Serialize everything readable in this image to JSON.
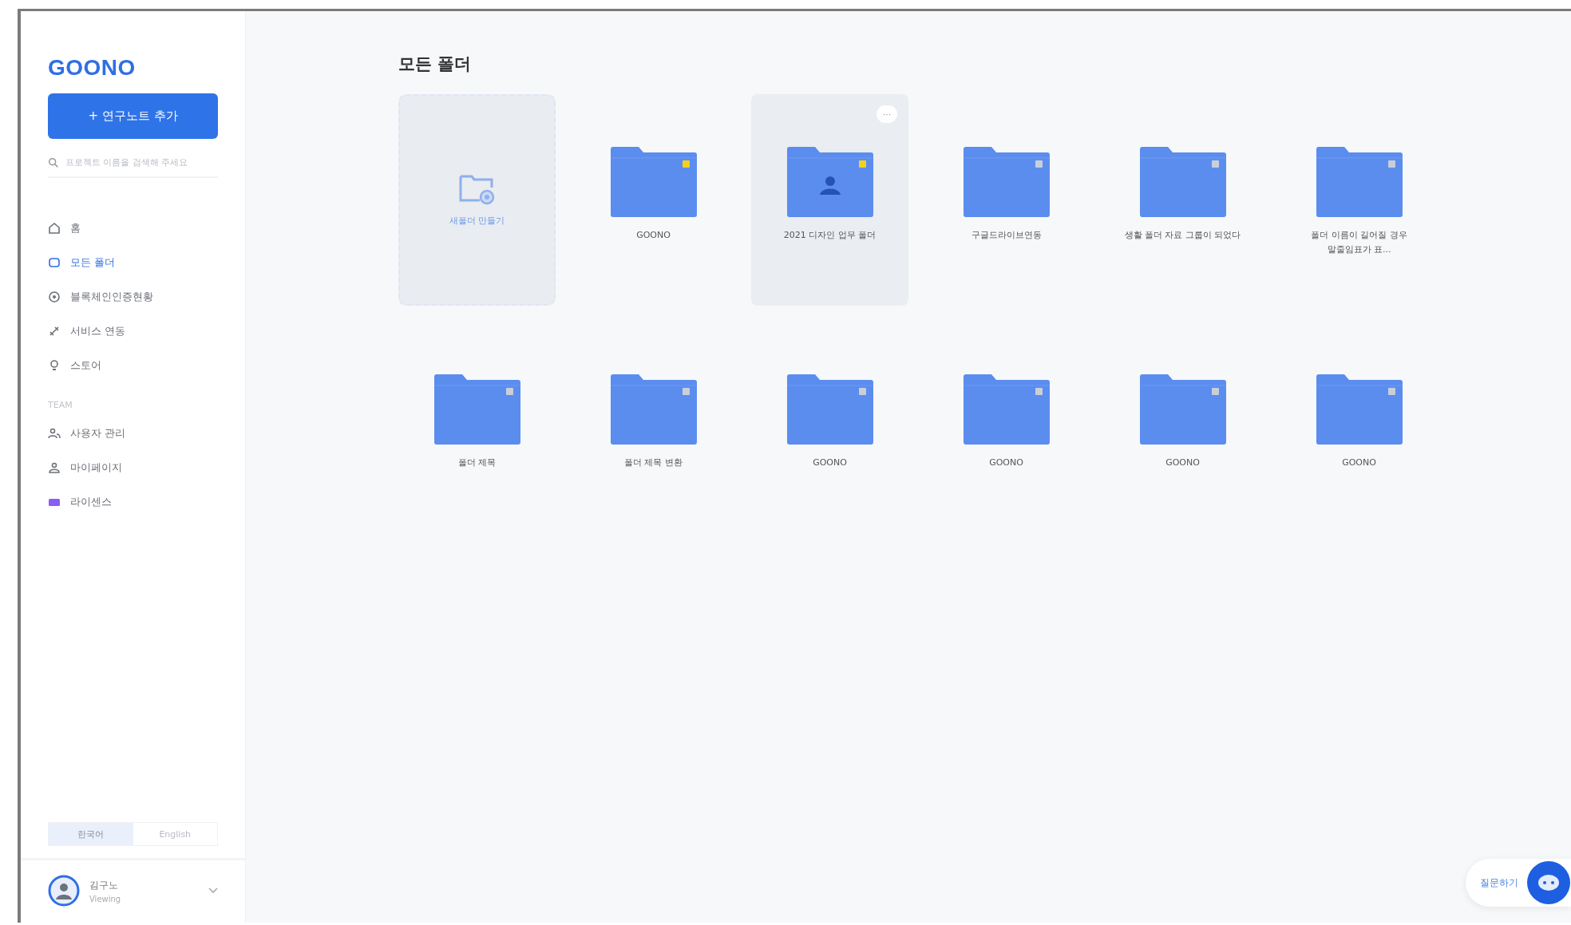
{
  "sidebar": {
    "logo": "GOONO",
    "add_button": "+ 연구노트 추가",
    "search": {
      "placeholder": "프로젝트 이름을 검색해 주세요"
    },
    "nav_items": [
      {
        "label": "홈",
        "selected": false
      },
      {
        "label": "모든 폴더",
        "selected": true
      },
      {
        "label": "블록체인인증현황",
        "selected": false
      },
      {
        "label": "서비스 연동",
        "selected": false
      },
      {
        "label": "스토어",
        "selected": false
      }
    ],
    "section_label": "TEAM",
    "team_items": [
      {
        "label": "사용자 관리",
        "selected": false
      },
      {
        "label": "마이페이지",
        "selected": false
      },
      {
        "label": "라이센스",
        "selected": false
      }
    ],
    "languages": [
      {
        "label": "한국어",
        "selected": true
      },
      {
        "label": "English",
        "selected": false
      }
    ],
    "user": {
      "name": "김구노",
      "role": "Viewing"
    }
  },
  "main": {
    "title": "모든 폴더",
    "new_folder": "새폴더 만들기",
    "folders": [
      {
        "name": "GOONO",
        "favorite": true,
        "shared": false,
        "highlighted": false
      },
      {
        "name": "2021 디자인 업무 폴더",
        "favorite": true,
        "shared": true,
        "highlighted": true,
        "menu": "···"
      },
      {
        "name": "구글드라이브연동",
        "favorite": false,
        "shared": false,
        "highlighted": false
      },
      {
        "name": "생활 폴더 자료 그룹이 되었다",
        "favorite": false,
        "shared": false,
        "highlighted": false
      },
      {
        "name": "폴더 이름이 길어질 경우 말줄임표가 표...",
        "favorite": false,
        "shared": false,
        "highlighted": false
      },
      {
        "name": "폴더 제목",
        "favorite": false,
        "shared": false,
        "highlighted": false
      },
      {
        "name": "폴더 제목 변환",
        "favorite": false,
        "shared": false,
        "highlighted": false
      },
      {
        "name": "GOONO",
        "favorite": false,
        "shared": false,
        "highlighted": false
      },
      {
        "name": "GOONO",
        "favorite": false,
        "shared": false,
        "highlighted": false
      },
      {
        "name": "GOONO",
        "favorite": false,
        "shared": false,
        "highlighted": false
      },
      {
        "name": "GOONO",
        "favorite": false,
        "shared": false,
        "highlighted": false
      }
    ]
  },
  "chat_button": "질문하기"
}
